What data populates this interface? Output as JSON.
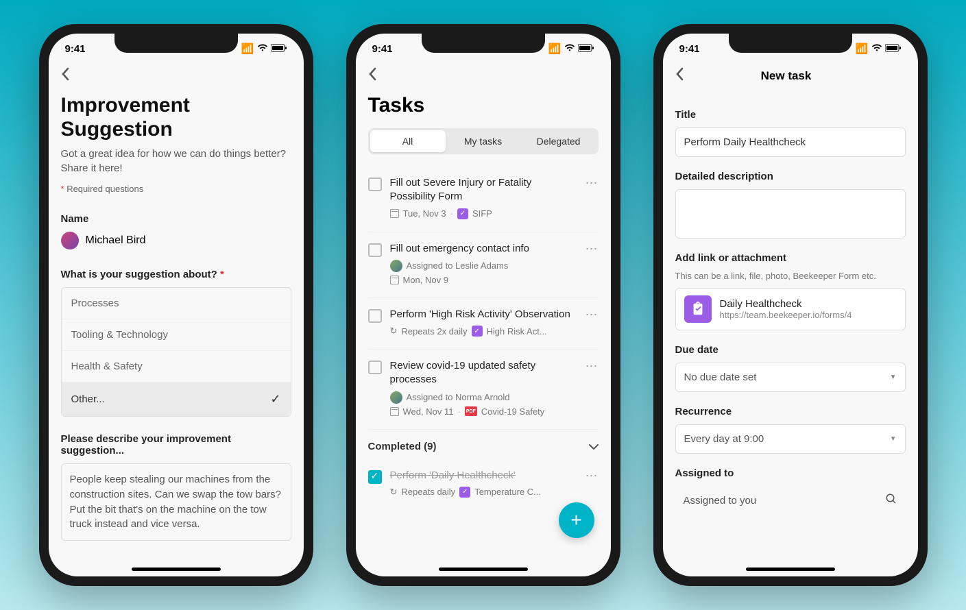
{
  "status_bar": {
    "time": "9:41"
  },
  "phone1": {
    "title": "Improvement Suggestion",
    "subtitle": "Got a great idea for how we can do things better? Share it here!",
    "required_label": "Required questions",
    "name_label": "Name",
    "user_name": "Michael Bird",
    "question_label": "What is your suggestion about?",
    "options": [
      "Processes",
      "Tooling & Technology",
      "Health & Safety",
      "Other..."
    ],
    "selected_option_index": 3,
    "describe_label": "Please describe your improvement suggestion...",
    "describe_text": "People keep stealing our machines from the construction sites. Can we swap the tow bars? Put the bit that's on the machine on the tow truck instead and vice versa."
  },
  "phone2": {
    "title": "Tasks",
    "tabs": [
      "All",
      "My tasks",
      "Delegated"
    ],
    "active_tab_index": 0,
    "tasks": [
      {
        "title": "Fill out Severe Injury or Fatality Possibility Form",
        "date": "Tue, Nov 3",
        "tag": "SIFP",
        "tag_type": "purple"
      },
      {
        "title": "Fill out emergency contact info",
        "assigned_to": "Assigned to Leslie Adams",
        "date": "Mon, Nov 9"
      },
      {
        "title": "Perform 'High Risk Activity' Observation",
        "repeat": "Repeats 2x daily",
        "tag": "High Risk Act...",
        "tag_type": "purple"
      },
      {
        "title": "Review covid-19 updated safety processes",
        "assigned_to": "Assigned to Norma Arnold",
        "date": "Wed, Nov 11",
        "tag": "Covid-19 Safety",
        "tag_type": "red"
      }
    ],
    "completed_label": "Completed (9)",
    "completed_task": {
      "title": "Perform 'Daily Healthcheck'",
      "repeat": "Repeats daily",
      "tag": "Temperature C..."
    }
  },
  "phone3": {
    "nav_title": "New task",
    "title_label": "Title",
    "title_value": "Perform Daily Healthcheck",
    "description_label": "Detailed description",
    "attachment_label": "Add link or attachment",
    "attachment_sublabel": "This can be a link, file, photo, Beekeeper Form etc.",
    "attachment": {
      "name": "Daily Healthcheck",
      "url": "https://team.beekeeper.io/forms/4"
    },
    "due_date_label": "Due date",
    "due_date_value": "No due date set",
    "recurrence_label": "Recurrence",
    "recurrence_value": "Every day at 9:00",
    "assigned_label": "Assigned to",
    "assigned_value": "Assigned to you"
  }
}
